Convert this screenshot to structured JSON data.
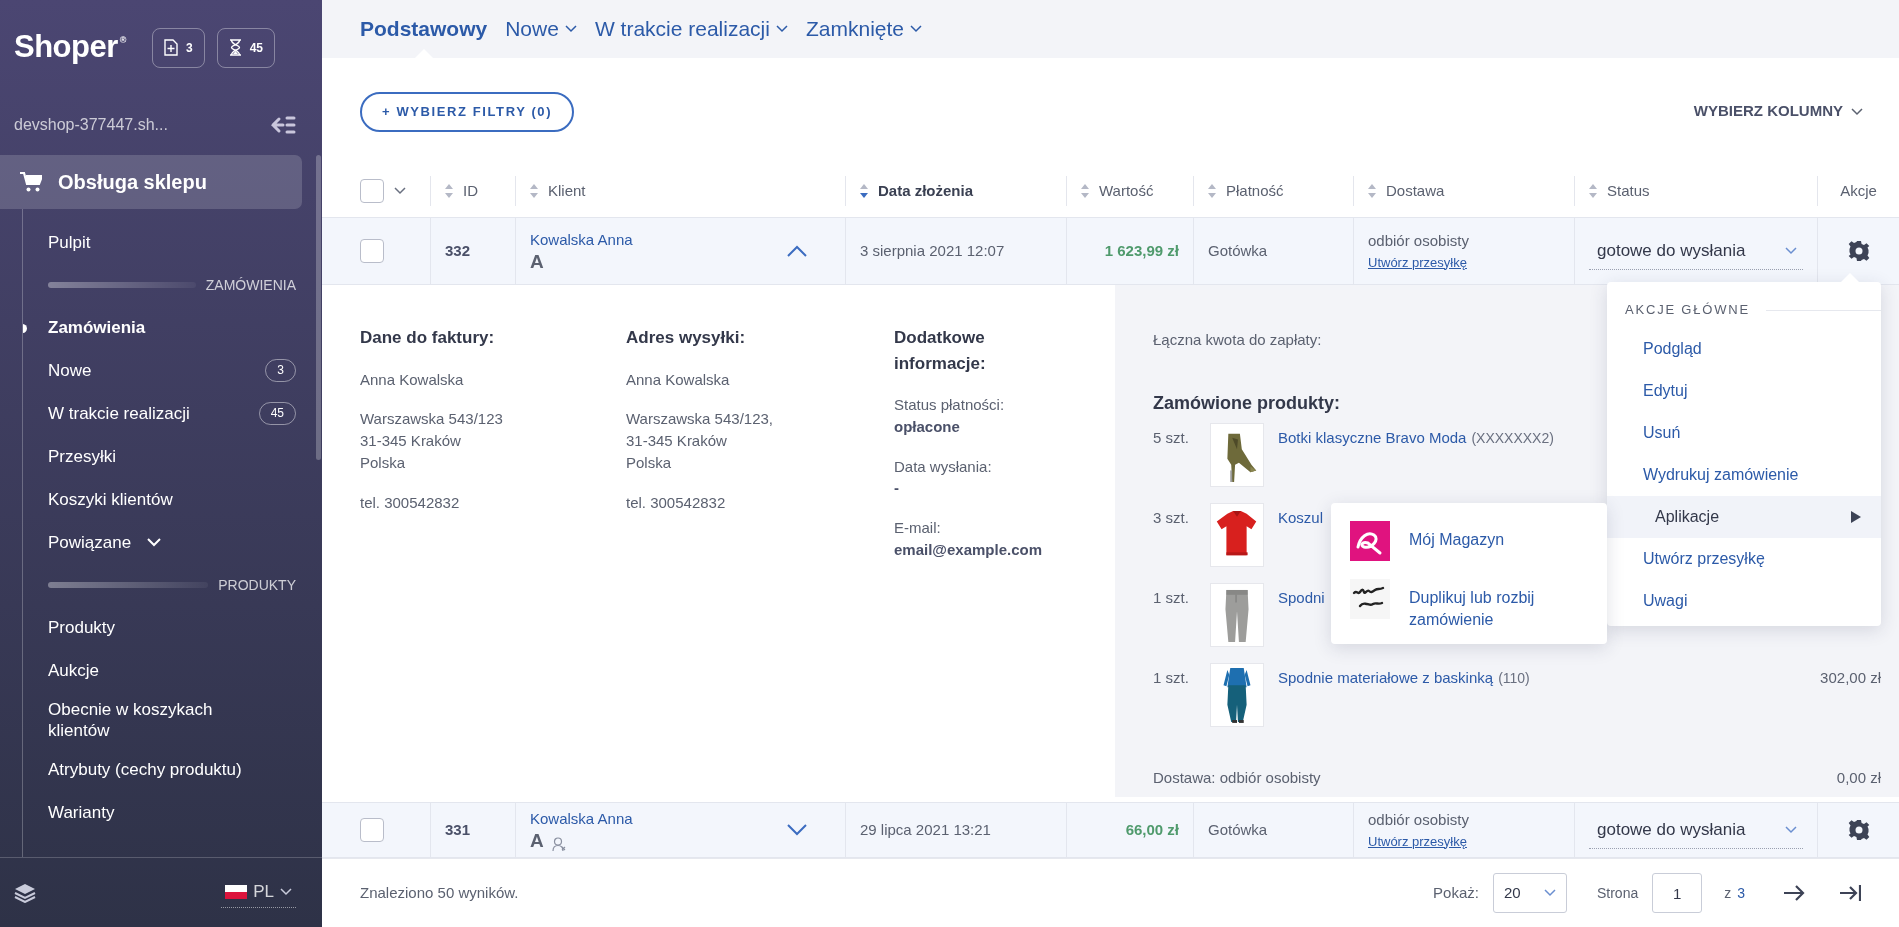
{
  "sidebar": {
    "logo": "Shoper",
    "logo_mark": "®",
    "counters": [
      {
        "kind": "document",
        "count": "3"
      },
      {
        "kind": "hourglass",
        "count": "45"
      }
    ],
    "shop_name": "devshop-377447.sh...",
    "section": "Obsługa sklepu",
    "items": [
      {
        "kind": "link",
        "label": "Pulpit",
        "selected": false
      },
      {
        "kind": "heading",
        "label": "ZAMÓWIENIA"
      },
      {
        "kind": "link",
        "label": "Zamówienia",
        "selected": true
      },
      {
        "kind": "link",
        "label": "Nowe",
        "selected": false,
        "badge": "3"
      },
      {
        "kind": "link",
        "label": "W trakcie realizacji",
        "selected": false,
        "badge": "45"
      },
      {
        "kind": "link",
        "label": "Przesyłki",
        "selected": false
      },
      {
        "kind": "link",
        "label": "Koszyki klientów",
        "selected": false
      },
      {
        "kind": "group",
        "label": "Powiązane",
        "expanded": false
      },
      {
        "kind": "heading",
        "label": "PRODUKTY"
      },
      {
        "kind": "link",
        "label": "Produkty",
        "selected": false
      },
      {
        "kind": "link",
        "label": "Aukcje",
        "selected": false
      },
      {
        "kind": "link",
        "label": "Obecnie w koszykach klientów",
        "selected": false
      },
      {
        "kind": "link",
        "label": "Atrybuty (cechy produktu)",
        "selected": false
      },
      {
        "kind": "link",
        "label": "Warianty",
        "selected": false
      }
    ],
    "language": "PL"
  },
  "tabs": [
    {
      "label": "Podstawowy",
      "selected": true,
      "dropdown": false
    },
    {
      "label": "Nowe",
      "selected": false,
      "dropdown": true
    },
    {
      "label": "W trakcie realizacji",
      "selected": false,
      "dropdown": true
    },
    {
      "label": "Zamknięte",
      "selected": false,
      "dropdown": true
    }
  ],
  "toolbar": {
    "filter_button": "+ WYBIERZ FILTRY (0)",
    "columns_button": "WYBIERZ KOLUMNY"
  },
  "table": {
    "select_all": {
      "checked": false
    },
    "columns": [
      {
        "label": "ID",
        "sortable": true,
        "sorted": false
      },
      {
        "label": "Klient",
        "sortable": true,
        "sorted": false
      },
      {
        "label": "Data złożenia",
        "sortable": true,
        "sorted": true
      },
      {
        "label": "Wartość",
        "sortable": true,
        "sorted": false
      },
      {
        "label": "Płatność",
        "sortable": true,
        "sorted": false
      },
      {
        "label": "Dostawa",
        "sortable": true,
        "sorted": false
      },
      {
        "label": "Status",
        "sortable": true,
        "sorted": false
      },
      {
        "label": "Akcje",
        "sortable": false,
        "sorted": false
      }
    ],
    "rows": [
      {
        "checked": false,
        "id": "332",
        "client": "Kowalska Anna",
        "client_tag": "A",
        "guest": false,
        "expanded": true,
        "date": "3 sierpnia 2021 12:07",
        "value": "1 623,99 zł",
        "payment": "Gotówka",
        "delivery": "odbiór osobisty",
        "shipment_link": "Utwórz przesyłkę",
        "status": "gotowe do wysłania"
      },
      {
        "checked": false,
        "id": "331",
        "client": "Kowalska Anna",
        "client_tag": "A",
        "guest": true,
        "expanded": false,
        "date": "29 lipca 2021 13:21",
        "value": "66,00 zł",
        "payment": "Gotówka",
        "delivery": "odbiór osobisty",
        "shipment_link": "Utwórz przesyłkę",
        "status": "gotowe do wysłania"
      }
    ]
  },
  "details": {
    "sections": [
      {
        "title": "Dane do faktury:",
        "blocks": [
          "Anna Kowalska",
          "Warszawska 543/123\n31-345 Kraków\nPolska",
          "tel. 300542832"
        ]
      },
      {
        "title": "Adres wysyłki:",
        "blocks": [
          "Anna Kowalska",
          "Warszawska 543/123,\n31-345 Kraków\nPolska",
          "tel. 300542832"
        ]
      }
    ],
    "extra": {
      "title": "Dodatkowe informacje:",
      "fields": [
        {
          "label": "Status płatności:",
          "value": "opłacone"
        },
        {
          "label": "Data wysłania:",
          "value": "-"
        },
        {
          "label": "E-mail:",
          "value": "email@example.com"
        }
      ]
    },
    "total_label": "Łączna kwota do zapłaty:",
    "products_title": "Zamówione produkty:",
    "products": [
      {
        "qty": "5 szt.",
        "name": "Botki klasyczne Bravo Moda",
        "code": "(XXXXXXX2)"
      },
      {
        "qty": "3 szt.",
        "name": "Koszul"
      },
      {
        "qty": "1 szt.",
        "name": "Spodni"
      },
      {
        "qty": "1 szt.",
        "name": "Spodnie materiałowe z baskinką",
        "code": "(110)",
        "price": "302,00 zł"
      }
    ],
    "delivery_label": "Dostawa: odbiór osobisty",
    "delivery_price": "0,00 zł"
  },
  "action_menu": {
    "title": "AKCJE GŁÓWNE",
    "items": [
      {
        "label": "Podgląd",
        "selected": false,
        "submenu": false
      },
      {
        "label": "Edytuj",
        "selected": false,
        "submenu": false
      },
      {
        "label": "Usuń",
        "selected": false,
        "submenu": false
      },
      {
        "label": "Wydrukuj zamówienie",
        "selected": false,
        "submenu": false
      },
      {
        "label": "Aplikacje",
        "selected": true,
        "submenu": true
      },
      {
        "label": "Utwórz przesyłkę",
        "selected": false,
        "submenu": false
      },
      {
        "label": "Uwagi",
        "selected": false,
        "submenu": false
      }
    ]
  },
  "submenu": {
    "items": [
      {
        "kind": "magazyn",
        "label": "Mój Magazyn"
      },
      {
        "kind": "duplicate",
        "label": "Duplikuj lub rozbij zamówienie"
      }
    ]
  },
  "footer": {
    "results": "Znaleziono 50 wyników.",
    "page_size_label": "Pokaż:",
    "page_size": "20",
    "page_label": "Strona",
    "page": "1",
    "of_label": "z",
    "page_count": "3"
  }
}
